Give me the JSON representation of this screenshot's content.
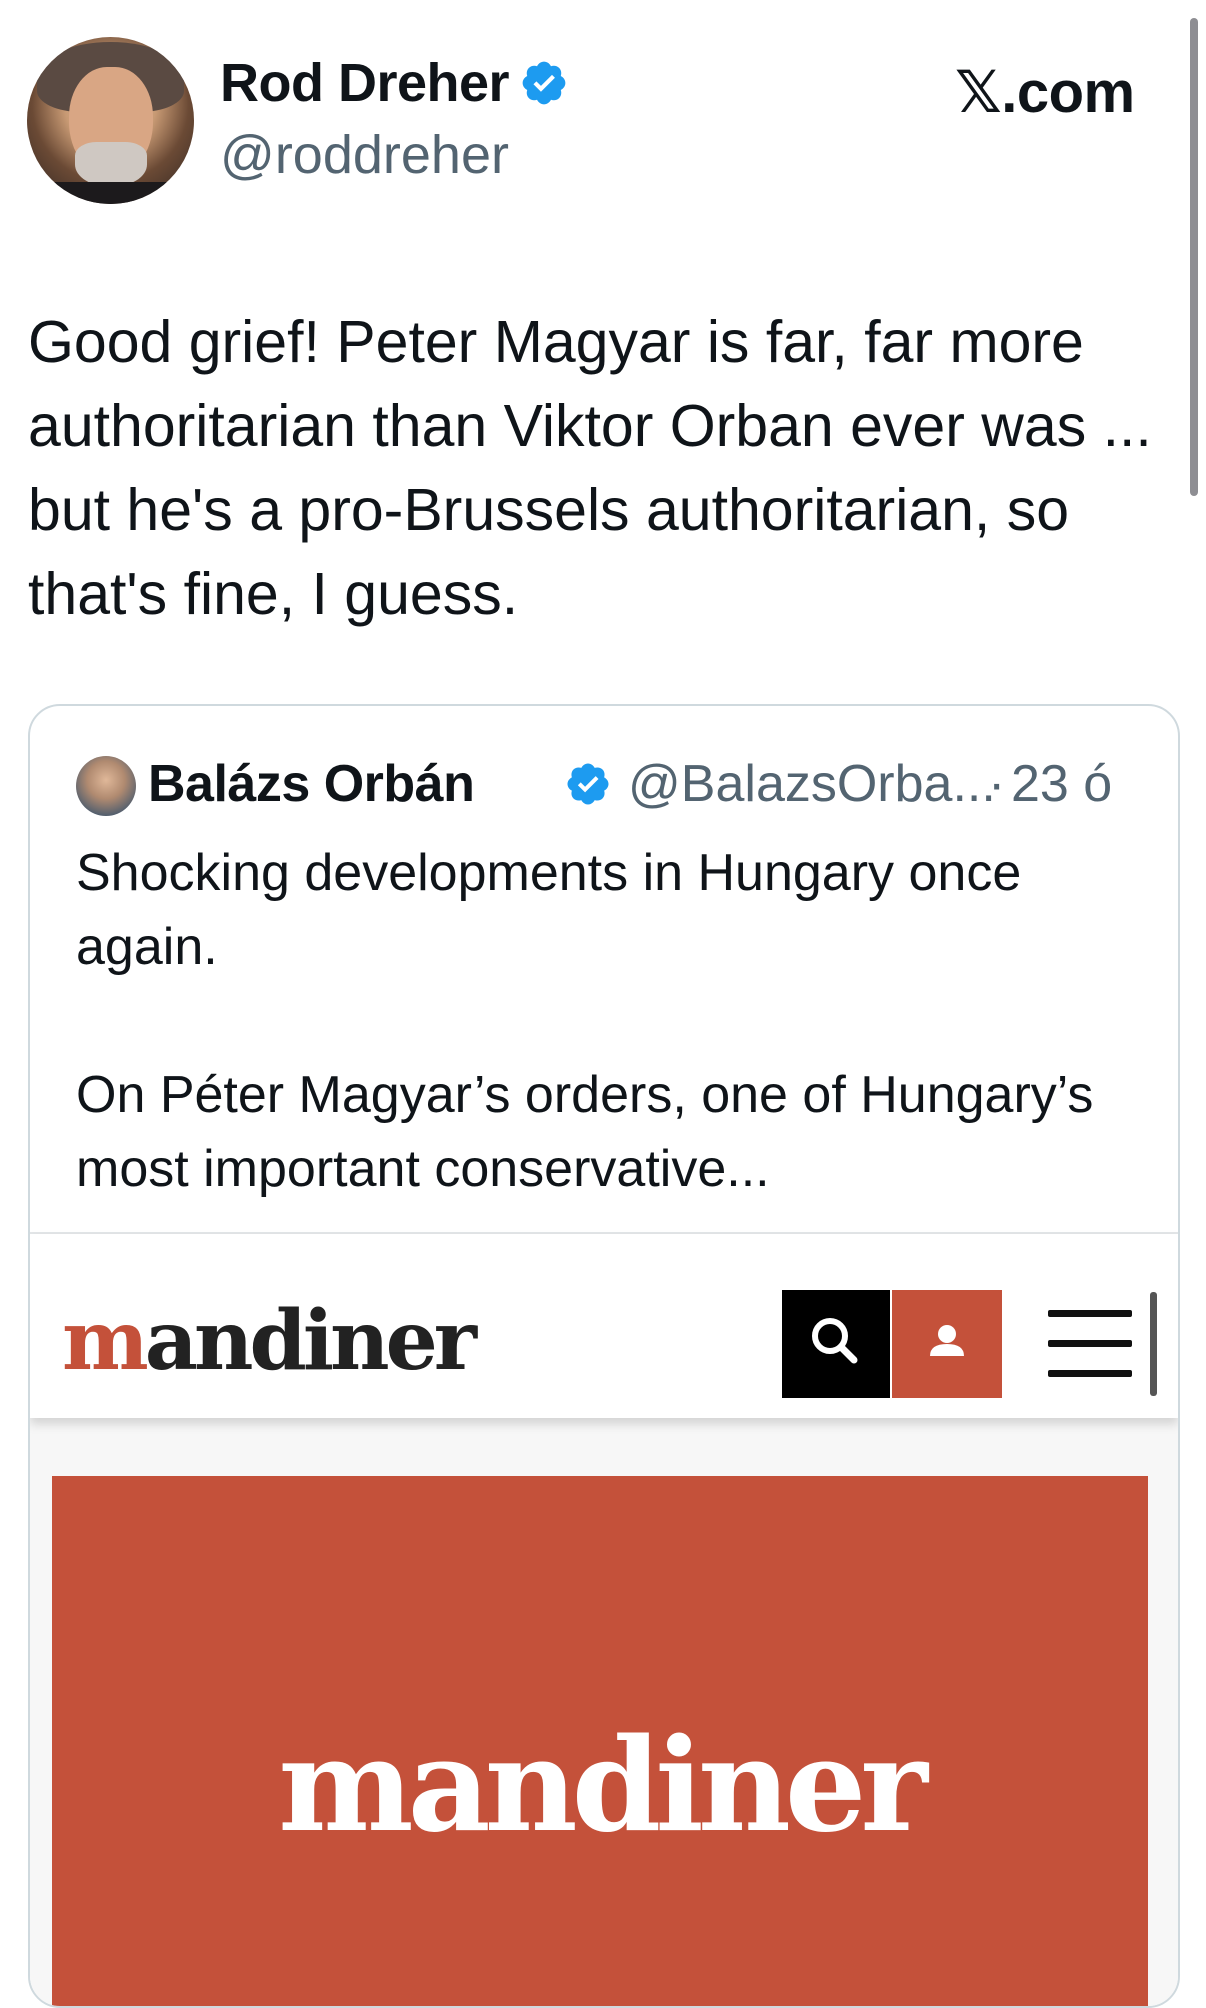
{
  "tweet": {
    "author_name": "Rod Dreher",
    "author_handle": "@roddreher",
    "site_label": "𝕏.com",
    "text": "Good grief! Peter Magyar is far, far more authoritarian than Viktor Orban ever was ... but he's a pro-Brussels authoritarian, so that's fine, I guess."
  },
  "quote": {
    "author_name": "Balázs Orbán",
    "author_handle": "@BalazsOrba...",
    "separator": "·",
    "time": "23 ó",
    "paragraph_1": "Shocking developments in Hungary once again.",
    "paragraph_2": "On Péter Magyar’s orders, one of Hungary’s most important conservative..."
  },
  "embed": {
    "site_logo_accent": "m",
    "site_logo_rest": "andiner",
    "banner_logo": "mandiner"
  },
  "colors": {
    "verified_blue": "#1d9bf0",
    "brand_red": "#c4513a",
    "text_primary": "#0f1419",
    "text_secondary": "#536471"
  },
  "icons": {
    "verified": "verified-badge-icon",
    "search": "search-icon",
    "user": "user-icon",
    "menu": "hamburger-menu-icon"
  }
}
